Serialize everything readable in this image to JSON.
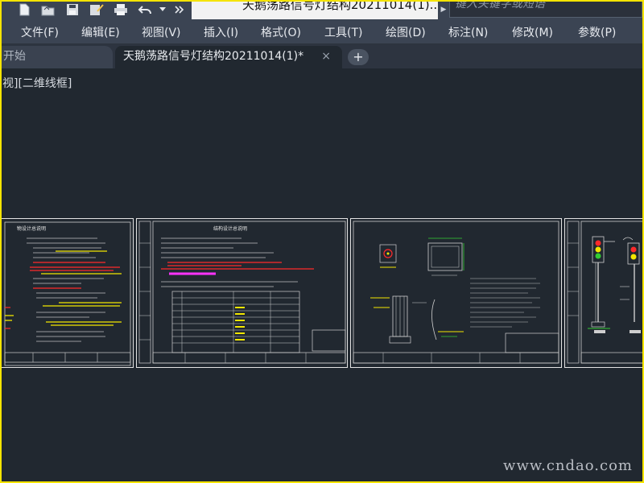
{
  "title_bar": {
    "document_title": "天鹅荡路信号灯结构20211014(1)...",
    "search_placeholder": "键入关键字或短语"
  },
  "menu": [
    {
      "label": "文件(F)"
    },
    {
      "label": "编辑(E)"
    },
    {
      "label": "视图(V)"
    },
    {
      "label": "插入(I)"
    },
    {
      "label": "格式(O)"
    },
    {
      "label": "工具(T)"
    },
    {
      "label": "绘图(D)"
    },
    {
      "label": "标注(N)"
    },
    {
      "label": "修改(M)"
    },
    {
      "label": "参数(P)"
    }
  ],
  "tabs": {
    "start": "开始",
    "active": "天鹅荡路信号灯结构20211014(1)*",
    "close": "×",
    "add": "+"
  },
  "viewport_label": "视][二维线框]",
  "sheets": [
    {
      "title": "物设计总说明"
    },
    {
      "title": "结构设计总说明"
    },
    {
      "title": ""
    },
    {
      "title": ""
    }
  ],
  "watermark": "www.cndao.com",
  "colors": {
    "canvas": "#212830",
    "chrome": "#3b4453",
    "frame_border": "#f5e400",
    "sheet_lines": "#e4e4e4",
    "note_yellow": "#f2e600",
    "note_red": "#ff2a2a",
    "note_magenta": "#ff33ff",
    "note_green": "#33cc33"
  }
}
